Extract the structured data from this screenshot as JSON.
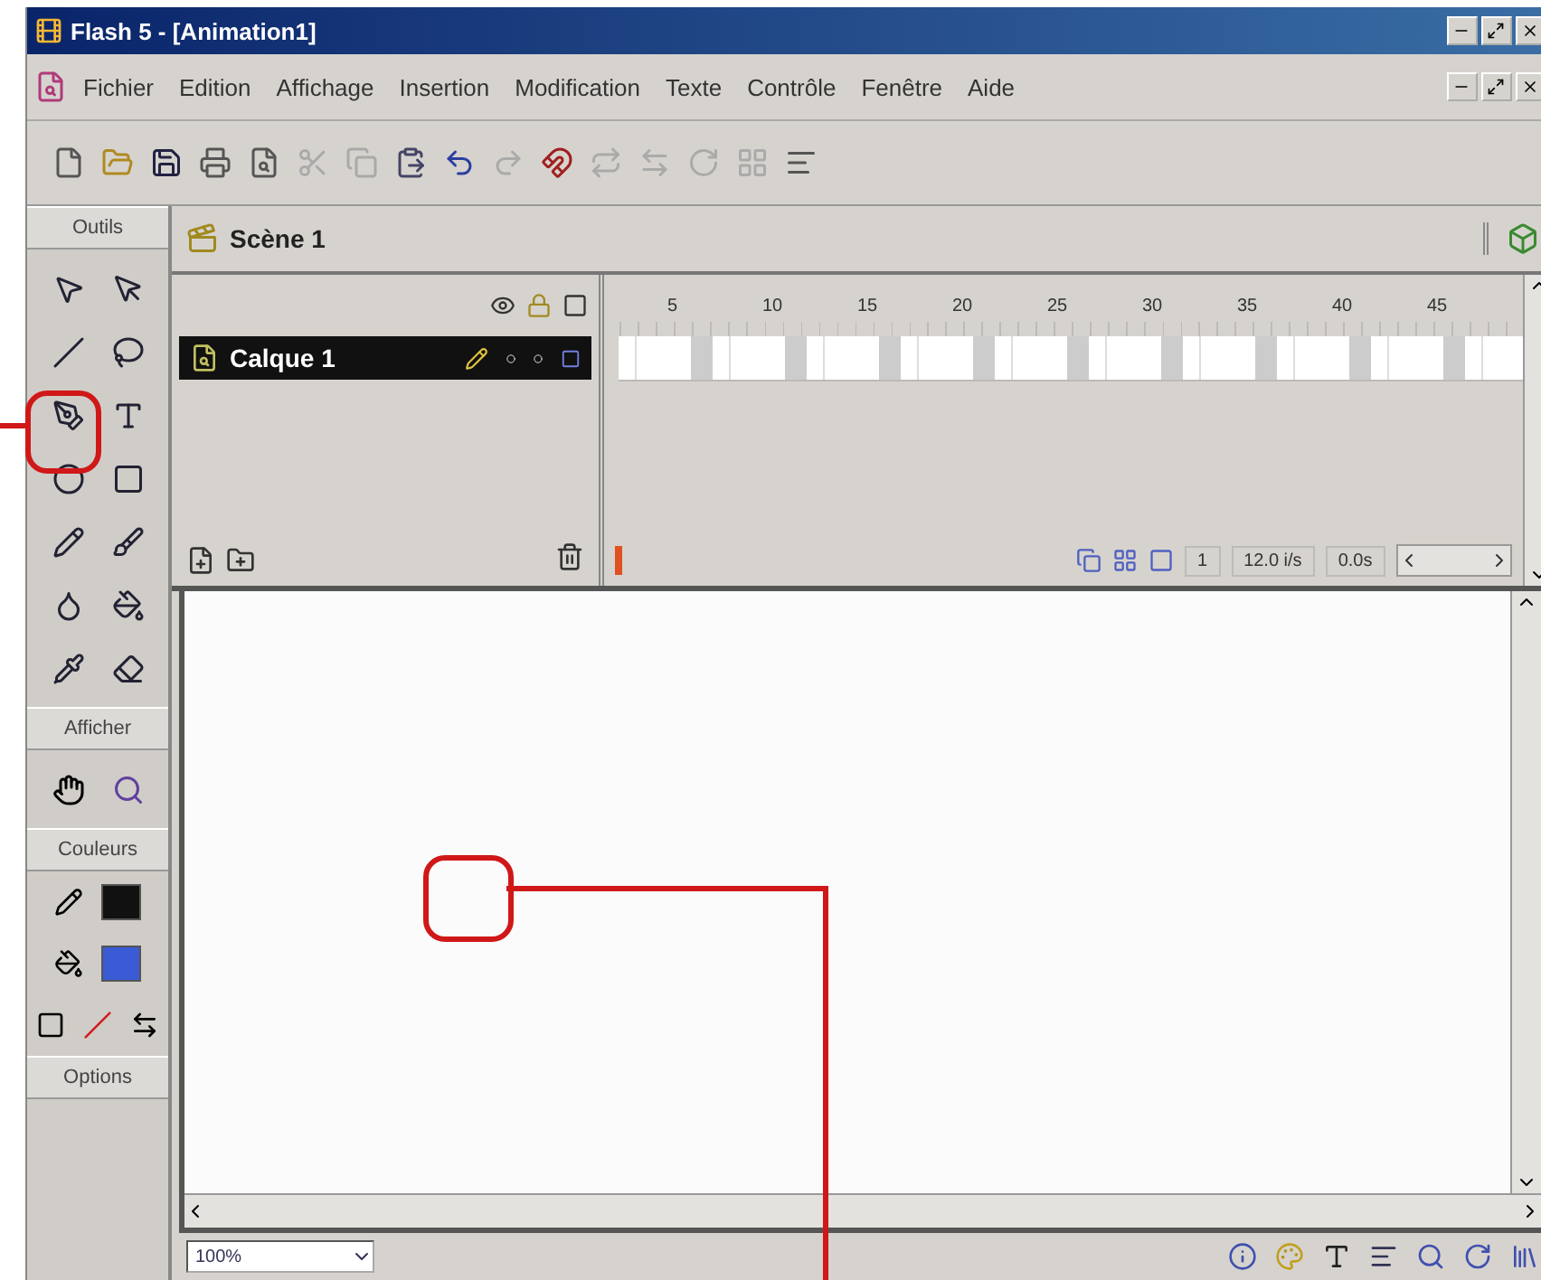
{
  "window": {
    "title": "Flash 5 - [Animation1]"
  },
  "menu": [
    "Fichier",
    "Edition",
    "Affichage",
    "Insertion",
    "Modification",
    "Texte",
    "Contrôle",
    "Fenêtre",
    "Aide"
  ],
  "toolbox": {
    "title": "Outils",
    "sections": [
      "Afficher",
      "Couleurs",
      "Options"
    ],
    "colors": [
      {
        "kind": "stroke",
        "color": "#111111"
      },
      {
        "kind": "fill",
        "color": "#3a5ad6"
      }
    ]
  },
  "scene": {
    "name": "Scène 1"
  },
  "timeline": {
    "layers": [
      {
        "name": "Calque 1",
        "selected": true
      }
    ],
    "ruler": [
      "5",
      "10",
      "15",
      "20",
      "25",
      "30",
      "35",
      "40",
      "45"
    ],
    "frame": "1",
    "rate": "12.0 i/s",
    "time": "0.0s"
  },
  "status_bar": {
    "zoom": "100%"
  }
}
